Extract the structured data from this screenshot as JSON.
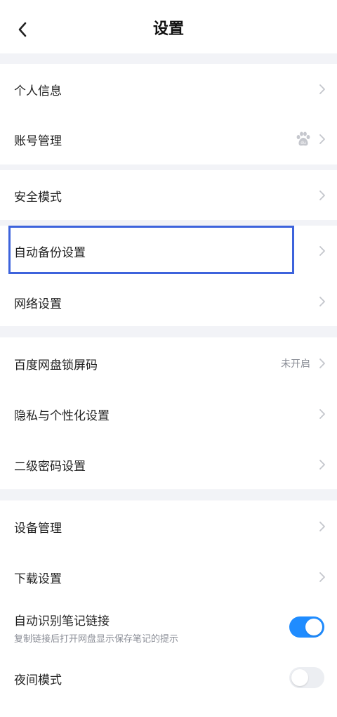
{
  "header": {
    "title": "设置"
  },
  "rows": {
    "personal_info": "个人信息",
    "account": "账号管理",
    "safe_mode": "安全模式",
    "auto_backup": "自动备份设置",
    "network": "网络设置",
    "lock_screen": "百度网盘锁屏码",
    "lock_screen_status": "未开启",
    "privacy": "隐私与个性化设置",
    "secondary_password": "二级密码设置",
    "device": "设备管理",
    "download": "下载设置",
    "note_link": "自动识别笔记链接",
    "note_link_desc": "复制链接后打开网盘显示保存笔记的提示",
    "night_mode": "夜间模式"
  },
  "toggles": {
    "note_link": true,
    "night_mode": false
  },
  "colors": {
    "accent": "#1f8cff",
    "highlight": "#3d63dc",
    "gap": "#f2f3f7"
  }
}
